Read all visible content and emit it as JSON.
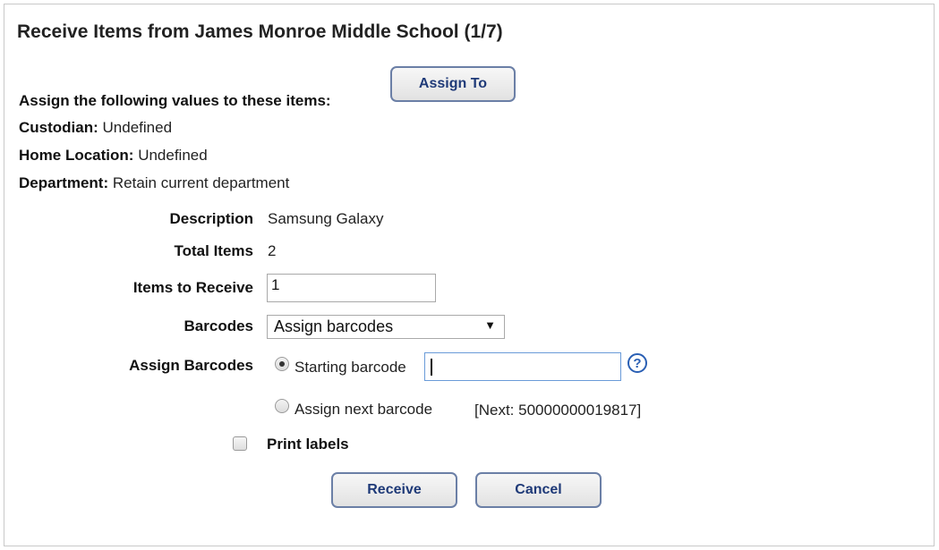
{
  "dialog": {
    "title": "Receive Items from James Monroe Middle School (1/7)"
  },
  "assignment": {
    "heading": "Assign the following values to these items:",
    "assign_button_label": "Assign To",
    "custodian_label": "Custodian:",
    "custodian_value": "Undefined",
    "home_location_label": "Home Location:",
    "home_location_value": "Undefined",
    "department_label": "Department:",
    "department_value": "Retain current department"
  },
  "form": {
    "description_label": "Description",
    "description_value": "Samsung Galaxy",
    "total_items_label": "Total Items",
    "total_items_value": "2",
    "items_to_receive_label": "Items to Receive",
    "items_to_receive_value": "1",
    "barcodes_label": "Barcodes",
    "barcodes_selected": "Assign barcodes",
    "assign_barcodes_label": "Assign Barcodes",
    "starting_barcode_label": "Starting barcode",
    "starting_barcode_selected": true,
    "starting_barcode_value": "",
    "help_icon": "question-circle-icon",
    "help_symbol": "?",
    "assign_next_label": "Assign next barcode",
    "next_barcode_text": "[Next: 50000000019817]",
    "print_labels_label": "Print labels",
    "print_labels_checked": false
  },
  "actions": {
    "receive_label": "Receive",
    "cancel_label": "Cancel"
  },
  "colors": {
    "button_text": "#1f3a78",
    "button_border": "#6b7fa6",
    "help_icon": "#2a5fb4"
  }
}
